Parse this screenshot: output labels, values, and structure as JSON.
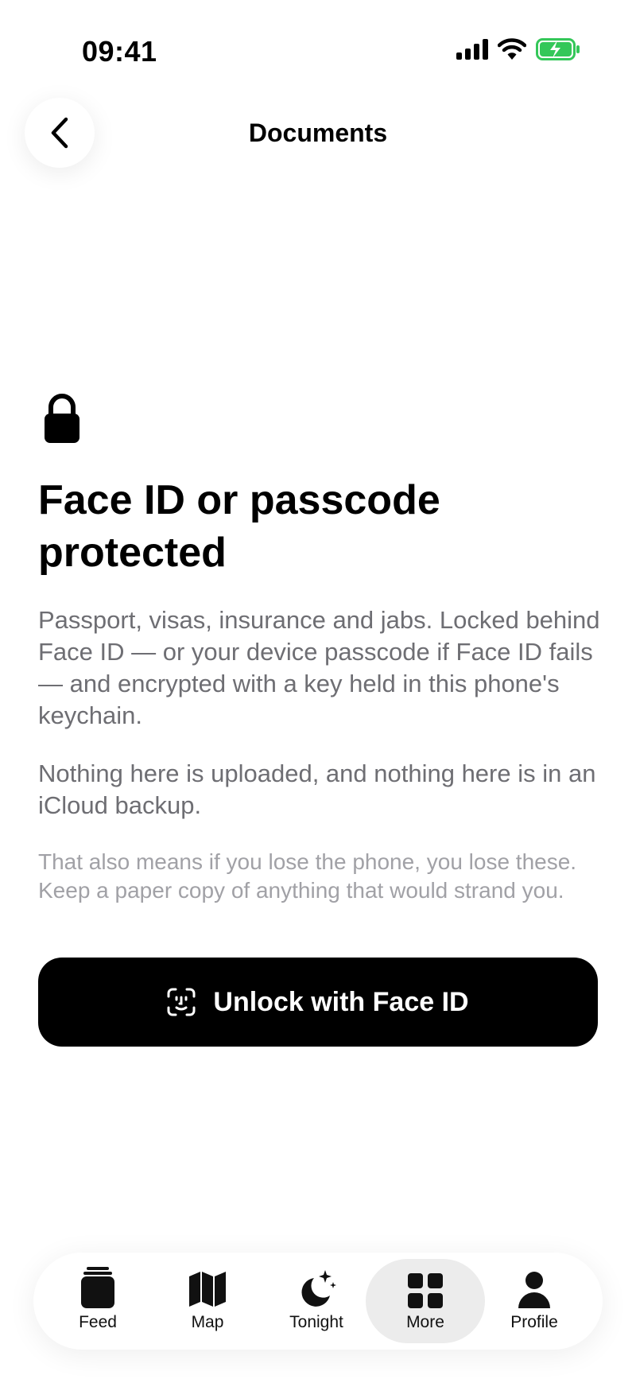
{
  "status_bar": {
    "time": "09:41"
  },
  "nav": {
    "title": "Documents"
  },
  "content": {
    "headline": "Face ID or passcode protected",
    "paragraph_1": "Passport, visas, insurance and jabs. Locked behind Face ID — or your device passcode if Face ID fails — and encrypted with a key held in this phone's keychain.",
    "paragraph_2": "Nothing here is uploaded, and nothing here is in an iCloud backup.",
    "paragraph_3": "That also means if you lose the phone, you lose these. Keep a paper copy of anything that would strand you."
  },
  "unlock_button": {
    "label": "Unlock with Face ID"
  },
  "tab_bar": {
    "tabs": [
      {
        "label": "Feed",
        "icon": "feed-icon"
      },
      {
        "label": "Map",
        "icon": "map-icon"
      },
      {
        "label": "Tonight",
        "icon": "moon-sparkle-icon"
      },
      {
        "label": "More",
        "icon": "grid-icon",
        "active": true
      },
      {
        "label": "Profile",
        "icon": "person-icon"
      }
    ]
  },
  "colors": {
    "battery_green": "#34c759",
    "body_text": "#6e6e73",
    "muted_text": "#a1a1a6"
  }
}
